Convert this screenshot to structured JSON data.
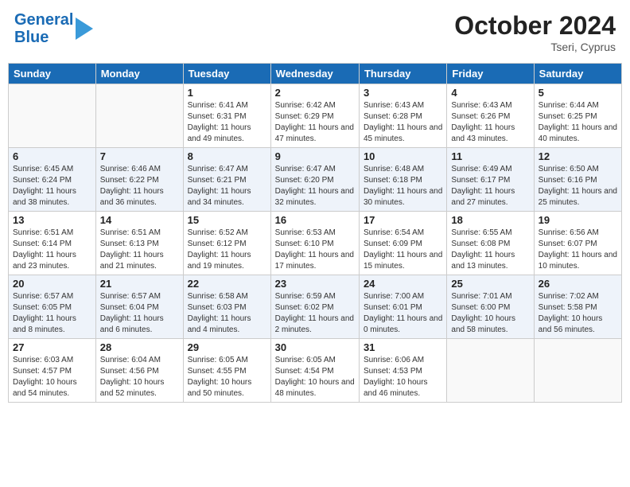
{
  "header": {
    "logo_line1": "General",
    "logo_line2": "Blue",
    "month_title": "October 2024",
    "location": "Tseri, Cyprus"
  },
  "columns": [
    "Sunday",
    "Monday",
    "Tuesday",
    "Wednesday",
    "Thursday",
    "Friday",
    "Saturday"
  ],
  "weeks": [
    [
      {
        "day": "",
        "sunrise": "",
        "sunset": "",
        "daylight": ""
      },
      {
        "day": "",
        "sunrise": "",
        "sunset": "",
        "daylight": ""
      },
      {
        "day": "1",
        "sunrise": "Sunrise: 6:41 AM",
        "sunset": "Sunset: 6:31 PM",
        "daylight": "Daylight: 11 hours and 49 minutes."
      },
      {
        "day": "2",
        "sunrise": "Sunrise: 6:42 AM",
        "sunset": "Sunset: 6:29 PM",
        "daylight": "Daylight: 11 hours and 47 minutes."
      },
      {
        "day": "3",
        "sunrise": "Sunrise: 6:43 AM",
        "sunset": "Sunset: 6:28 PM",
        "daylight": "Daylight: 11 hours and 45 minutes."
      },
      {
        "day": "4",
        "sunrise": "Sunrise: 6:43 AM",
        "sunset": "Sunset: 6:26 PM",
        "daylight": "Daylight: 11 hours and 43 minutes."
      },
      {
        "day": "5",
        "sunrise": "Sunrise: 6:44 AM",
        "sunset": "Sunset: 6:25 PM",
        "daylight": "Daylight: 11 hours and 40 minutes."
      }
    ],
    [
      {
        "day": "6",
        "sunrise": "Sunrise: 6:45 AM",
        "sunset": "Sunset: 6:24 PM",
        "daylight": "Daylight: 11 hours and 38 minutes."
      },
      {
        "day": "7",
        "sunrise": "Sunrise: 6:46 AM",
        "sunset": "Sunset: 6:22 PM",
        "daylight": "Daylight: 11 hours and 36 minutes."
      },
      {
        "day": "8",
        "sunrise": "Sunrise: 6:47 AM",
        "sunset": "Sunset: 6:21 PM",
        "daylight": "Daylight: 11 hours and 34 minutes."
      },
      {
        "day": "9",
        "sunrise": "Sunrise: 6:47 AM",
        "sunset": "Sunset: 6:20 PM",
        "daylight": "Daylight: 11 hours and 32 minutes."
      },
      {
        "day": "10",
        "sunrise": "Sunrise: 6:48 AM",
        "sunset": "Sunset: 6:18 PM",
        "daylight": "Daylight: 11 hours and 30 minutes."
      },
      {
        "day": "11",
        "sunrise": "Sunrise: 6:49 AM",
        "sunset": "Sunset: 6:17 PM",
        "daylight": "Daylight: 11 hours and 27 minutes."
      },
      {
        "day": "12",
        "sunrise": "Sunrise: 6:50 AM",
        "sunset": "Sunset: 6:16 PM",
        "daylight": "Daylight: 11 hours and 25 minutes."
      }
    ],
    [
      {
        "day": "13",
        "sunrise": "Sunrise: 6:51 AM",
        "sunset": "Sunset: 6:14 PM",
        "daylight": "Daylight: 11 hours and 23 minutes."
      },
      {
        "day": "14",
        "sunrise": "Sunrise: 6:51 AM",
        "sunset": "Sunset: 6:13 PM",
        "daylight": "Daylight: 11 hours and 21 minutes."
      },
      {
        "day": "15",
        "sunrise": "Sunrise: 6:52 AM",
        "sunset": "Sunset: 6:12 PM",
        "daylight": "Daylight: 11 hours and 19 minutes."
      },
      {
        "day": "16",
        "sunrise": "Sunrise: 6:53 AM",
        "sunset": "Sunset: 6:10 PM",
        "daylight": "Daylight: 11 hours and 17 minutes."
      },
      {
        "day": "17",
        "sunrise": "Sunrise: 6:54 AM",
        "sunset": "Sunset: 6:09 PM",
        "daylight": "Daylight: 11 hours and 15 minutes."
      },
      {
        "day": "18",
        "sunrise": "Sunrise: 6:55 AM",
        "sunset": "Sunset: 6:08 PM",
        "daylight": "Daylight: 11 hours and 13 minutes."
      },
      {
        "day": "19",
        "sunrise": "Sunrise: 6:56 AM",
        "sunset": "Sunset: 6:07 PM",
        "daylight": "Daylight: 11 hours and 10 minutes."
      }
    ],
    [
      {
        "day": "20",
        "sunrise": "Sunrise: 6:57 AM",
        "sunset": "Sunset: 6:05 PM",
        "daylight": "Daylight: 11 hours and 8 minutes."
      },
      {
        "day": "21",
        "sunrise": "Sunrise: 6:57 AM",
        "sunset": "Sunset: 6:04 PM",
        "daylight": "Daylight: 11 hours and 6 minutes."
      },
      {
        "day": "22",
        "sunrise": "Sunrise: 6:58 AM",
        "sunset": "Sunset: 6:03 PM",
        "daylight": "Daylight: 11 hours and 4 minutes."
      },
      {
        "day": "23",
        "sunrise": "Sunrise: 6:59 AM",
        "sunset": "Sunset: 6:02 PM",
        "daylight": "Daylight: 11 hours and 2 minutes."
      },
      {
        "day": "24",
        "sunrise": "Sunrise: 7:00 AM",
        "sunset": "Sunset: 6:01 PM",
        "daylight": "Daylight: 11 hours and 0 minutes."
      },
      {
        "day": "25",
        "sunrise": "Sunrise: 7:01 AM",
        "sunset": "Sunset: 6:00 PM",
        "daylight": "Daylight: 10 hours and 58 minutes."
      },
      {
        "day": "26",
        "sunrise": "Sunrise: 7:02 AM",
        "sunset": "Sunset: 5:58 PM",
        "daylight": "Daylight: 10 hours and 56 minutes."
      }
    ],
    [
      {
        "day": "27",
        "sunrise": "Sunrise: 6:03 AM",
        "sunset": "Sunset: 4:57 PM",
        "daylight": "Daylight: 10 hours and 54 minutes."
      },
      {
        "day": "28",
        "sunrise": "Sunrise: 6:04 AM",
        "sunset": "Sunset: 4:56 PM",
        "daylight": "Daylight: 10 hours and 52 minutes."
      },
      {
        "day": "29",
        "sunrise": "Sunrise: 6:05 AM",
        "sunset": "Sunset: 4:55 PM",
        "daylight": "Daylight: 10 hours and 50 minutes."
      },
      {
        "day": "30",
        "sunrise": "Sunrise: 6:05 AM",
        "sunset": "Sunset: 4:54 PM",
        "daylight": "Daylight: 10 hours and 48 minutes."
      },
      {
        "day": "31",
        "sunrise": "Sunrise: 6:06 AM",
        "sunset": "Sunset: 4:53 PM",
        "daylight": "Daylight: 10 hours and 46 minutes."
      },
      {
        "day": "",
        "sunrise": "",
        "sunset": "",
        "daylight": ""
      },
      {
        "day": "",
        "sunrise": "",
        "sunset": "",
        "daylight": ""
      }
    ]
  ]
}
